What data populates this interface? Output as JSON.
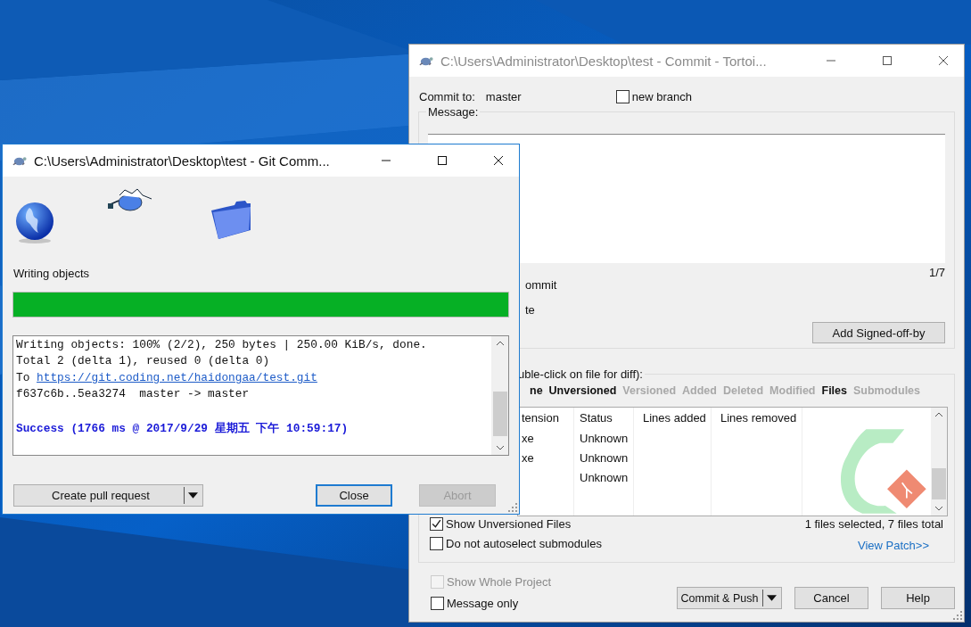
{
  "commit_window": {
    "title": "C:\\Users\\Administrator\\Desktop\\test - Commit - Tortoi...",
    "commit_to_label": "Commit to:",
    "branch": "master",
    "new_branch": {
      "label": "new branch",
      "checked": false
    },
    "message": {
      "label": "Message:"
    },
    "message_counter": "1/7",
    "option_fragments": [
      "ommit",
      "te"
    ],
    "add_signed_off_button": "Add Signed-off-by",
    "changes": {
      "label": "uble-click on file for diff):",
      "filters": [
        {
          "label": "ne",
          "active": true
        },
        {
          "label": "Unversioned",
          "active": true
        },
        {
          "label": "Versioned",
          "active": false
        },
        {
          "label": "Added",
          "active": false
        },
        {
          "label": "Deleted",
          "active": false
        },
        {
          "label": "Modified",
          "active": false
        },
        {
          "label": "Files",
          "active": true
        },
        {
          "label": "Submodules",
          "active": false
        }
      ],
      "columns": [
        "tension",
        "Status",
        "Lines added",
        "Lines removed"
      ],
      "rows": [
        {
          "extension": "xe",
          "status": "Unknown"
        },
        {
          "extension": "xe",
          "status": "Unknown"
        },
        {
          "status": "Unknown"
        }
      ],
      "checkboxes": [
        {
          "label": "Show Unversioned Files",
          "checked": true,
          "disabled": false
        },
        {
          "label": "Do not autoselect submodules",
          "checked": false,
          "disabled": false
        }
      ],
      "summary": "1 files selected, 7 files total",
      "view_patch": "View Patch>>"
    },
    "bottom_checkboxes": [
      {
        "label": "Show Whole Project",
        "checked": false,
        "disabled": true
      },
      {
        "label": "Message only",
        "checked": false,
        "disabled": false
      }
    ],
    "buttons": [
      {
        "label": "Commit & Push",
        "kind": "split"
      },
      {
        "label": "Cancel",
        "kind": "plain"
      },
      {
        "label": "Help",
        "kind": "plain"
      }
    ]
  },
  "progress_window": {
    "title": "C:\\Users\\Administrator\\Desktop\\test - Git Comm...",
    "status": "Writing objects",
    "progress": {
      "level": 1
    },
    "log": [
      {
        "kind": "text",
        "text": "Writing objects: 100% (2/2), 250 bytes | 250.00 KiB/s, done."
      },
      {
        "kind": "text",
        "text": "Total 2 (delta 1), reused 0 (delta 0)"
      },
      {
        "kind": "link",
        "prefix": "To",
        "url": "https://git.coding.net/haidongaa/test.git"
      },
      {
        "kind": "text",
        "text": "f637c6b..5ea3274  master -> master"
      },
      {
        "kind": "success",
        "text": "Success (1766 ms @ 2017/9/29 星期五 下午 10:59:17)"
      }
    ],
    "buttons": [
      {
        "label": "Create pull request",
        "kind": "split",
        "focused": false,
        "disabled": false
      },
      {
        "label": "Close",
        "kind": "plain",
        "focused": true,
        "disabled": false
      },
      {
        "label": "Abort",
        "kind": "plain",
        "focused": false,
        "disabled": true
      }
    ]
  }
}
